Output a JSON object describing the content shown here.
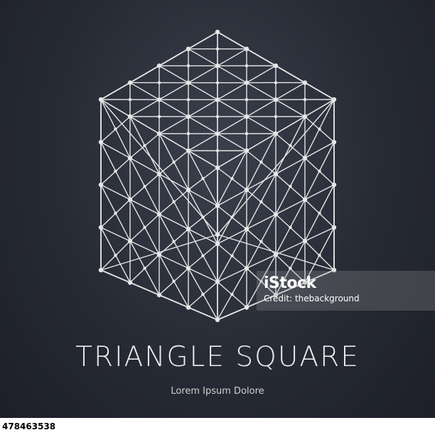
{
  "colors": {
    "background": "#262a34",
    "line_art": "#e6e6e6",
    "title_text": "#ececec"
  },
  "logo": {
    "icon": "hexagon-cube-lattice-icon",
    "title": "TRIANGLE SQUARE",
    "subtitle": "Lorem Ipsum Dolore"
  },
  "watermark": {
    "logo_text": "iStock",
    "credit": "Credit: thebackground"
  },
  "image_id": "478463538"
}
